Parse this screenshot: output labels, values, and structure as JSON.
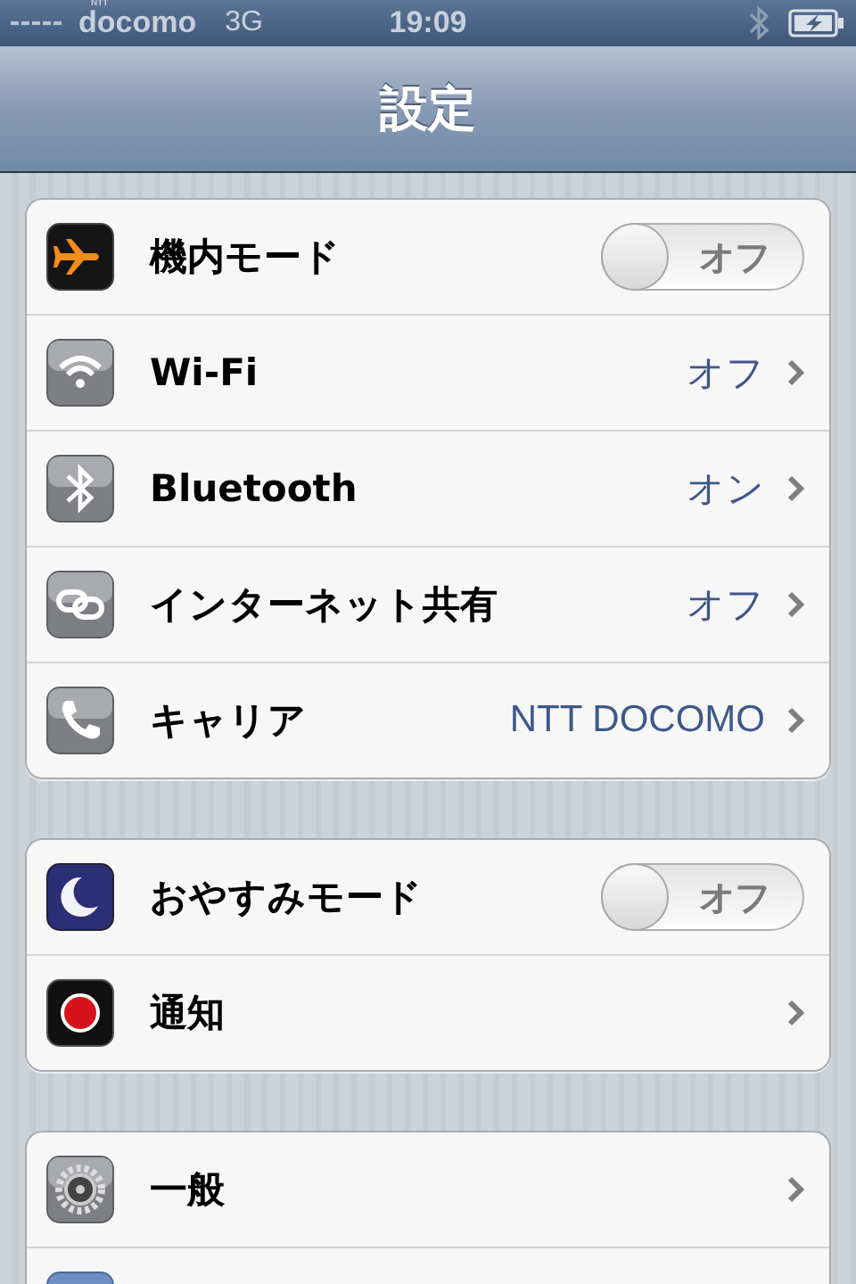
{
  "status_bar": {
    "carrier_mark": "NTT",
    "carrier": "docomo",
    "network": "3G",
    "time": "19:09"
  },
  "nav_bar": {
    "title": "設定"
  },
  "groups": [
    {
      "rows": [
        {
          "kind": "toggle",
          "label": "機内モード",
          "on": false,
          "value": "オフ"
        },
        {
          "kind": "disclosure",
          "label": "Wi-Fi",
          "value": "オフ"
        },
        {
          "kind": "disclosure",
          "label": "Bluetooth",
          "value": "オン"
        },
        {
          "kind": "disclosure",
          "label": "インターネット共有",
          "value": "オフ"
        },
        {
          "kind": "disclosure",
          "label": "キャリア",
          "value": "NTT DOCOMO"
        }
      ]
    },
    {
      "rows": [
        {
          "kind": "toggle",
          "label": "おやすみモード",
          "on": false,
          "value": "オフ"
        },
        {
          "kind": "disclosure",
          "label": "通知"
        }
      ]
    },
    {
      "rows": [
        {
          "kind": "disclosure",
          "label": "一般"
        },
        {
          "kind": "disclosure"
        }
      ]
    }
  ]
}
